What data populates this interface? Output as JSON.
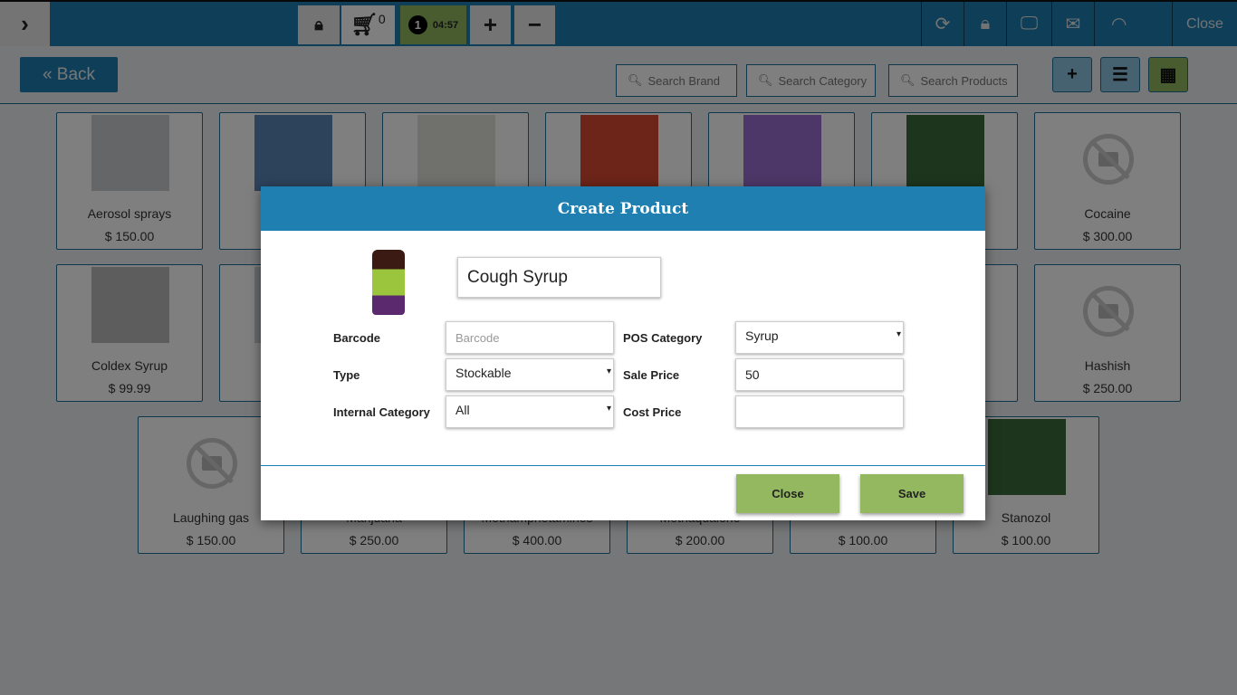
{
  "topbar": {
    "cart_count": "0",
    "order_number": "1",
    "timer": "04:57",
    "plus": "+",
    "minus": "−",
    "close_label": "Close",
    "colors": {
      "bar": "#1f7fb0",
      "timer_bg": "#93b85f"
    }
  },
  "toolbar": {
    "back_label": "« Back",
    "search_brand": "Search Brand",
    "search_category": "Search Category",
    "search_products": "Search Products"
  },
  "products": [
    {
      "name": "Aerosol sprays",
      "price": "$ 150.00",
      "image": "photo"
    },
    {
      "name": "A",
      "price": "",
      "image": "photo"
    },
    {
      "name": "",
      "price": "",
      "image": "photo"
    },
    {
      "name": "",
      "price": "",
      "image": "photo"
    },
    {
      "name": "",
      "price": "",
      "image": "photo"
    },
    {
      "name": "o",
      "price": "",
      "image": "photo"
    },
    {
      "name": "Cocaine",
      "price": "$ 300.00",
      "image": "no-photo"
    },
    {
      "name": "Coldex Syrup",
      "price": "$ 99.99",
      "image": "photo"
    },
    {
      "name": "D",
      "price": "",
      "image": "photo"
    },
    {
      "name": "",
      "price": "",
      "image": "photo"
    },
    {
      "name": "",
      "price": "",
      "image": "photo"
    },
    {
      "name": "",
      "price": "",
      "image": "photo"
    },
    {
      "name": "",
      "price": "",
      "image": "photo"
    },
    {
      "name": "Hashish",
      "price": "$ 250.00",
      "image": "no-photo"
    },
    {
      "name": "Laughing gas",
      "price": "$ 150.00",
      "image": "no-photo"
    },
    {
      "name": "Marijuana",
      "price": "$ 250.00",
      "image": "photo"
    },
    {
      "name": "Methamphetamines",
      "price": "$ 400.00",
      "image": "photo"
    },
    {
      "name": "Methaqualone",
      "price": "$ 200.00",
      "image": "photo"
    },
    {
      "name": "",
      "price": "$ 100.00",
      "image": "photo"
    },
    {
      "name": "Stanozol",
      "price": "$ 100.00",
      "image": "photo"
    }
  ],
  "modal": {
    "title": "Create Product",
    "product_name": "Cough Syrup",
    "barcode_label": "Barcode",
    "barcode_placeholder": "Barcode",
    "type_label": "Type",
    "type_value": "Stockable",
    "internal_category_label": "Internal Category",
    "internal_category_value": "All",
    "pos_category_label": "POS Category",
    "pos_category_value": "Syrup",
    "sale_price_label": "Sale Price",
    "sale_price_value": "50",
    "cost_price_label": "Cost Price",
    "cost_price_value": "",
    "close_label": "Close",
    "save_label": "Save"
  }
}
